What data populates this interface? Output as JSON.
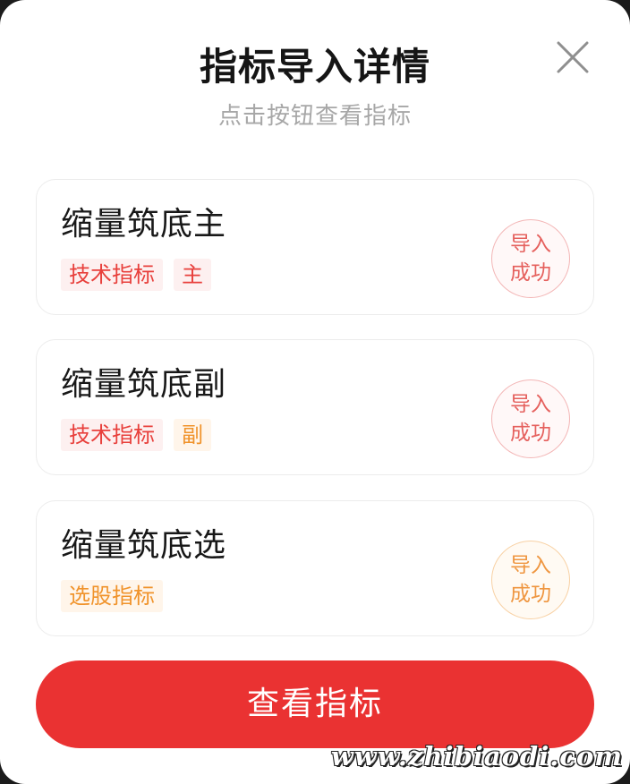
{
  "dialog": {
    "title": "指标导入详情",
    "subtitle": "点击按钮查看指标",
    "close_icon": "close-icon"
  },
  "cards": [
    {
      "name": "缩量筑底主",
      "tags": [
        "技术指标",
        "主"
      ],
      "status_line1": "导入",
      "status_line2": "成功"
    },
    {
      "name": "缩量筑底副",
      "tags": [
        "技术指标",
        "副"
      ],
      "status_line1": "导入",
      "status_line2": "成功"
    },
    {
      "name": "缩量筑底选",
      "tags": [
        "选股指标"
      ],
      "status_line1": "导入",
      "status_line2": "成功"
    }
  ],
  "actions": {
    "view_label": "查看指标"
  },
  "watermark": "www.zhibiaodi.com",
  "colors": {
    "accent_red": "#ea3232",
    "tag_red": "#e8403c",
    "tag_orange": "#f0932b",
    "status_red": "#e5605d",
    "status_orange": "#ef9640"
  }
}
